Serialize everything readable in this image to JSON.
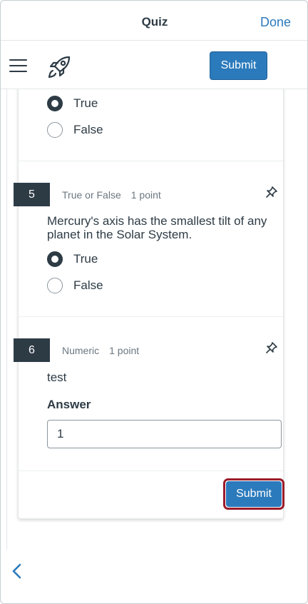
{
  "nav": {
    "title": "Quiz",
    "done_label": "Done"
  },
  "toolbar": {
    "submit_label": "Submit"
  },
  "prev_question": {
    "options": [
      {
        "label": "True",
        "selected": true
      },
      {
        "label": "False",
        "selected": false
      }
    ]
  },
  "questions": [
    {
      "number": "5",
      "type": "True or False",
      "points": "1 point",
      "text": "Mercury's axis has the smallest tilt of any planet in the Solar System.",
      "options": [
        {
          "label": "True",
          "selected": true
        },
        {
          "label": "False",
          "selected": false
        }
      ]
    },
    {
      "number": "6",
      "type": "Numeric",
      "points": "1 point",
      "text": "test",
      "answer_label": "Answer",
      "answer_value": "1"
    }
  ],
  "footer": {
    "submit_label": "Submit"
  },
  "icons": {
    "menu": "hamburger-menu-icon",
    "logo": "rocket-icon",
    "pin": "pin-icon",
    "back": "chevron-left-icon"
  },
  "colors": {
    "accent": "#2b7abc",
    "dark": "#2d3b45",
    "highlight": "#9b1b2a"
  }
}
